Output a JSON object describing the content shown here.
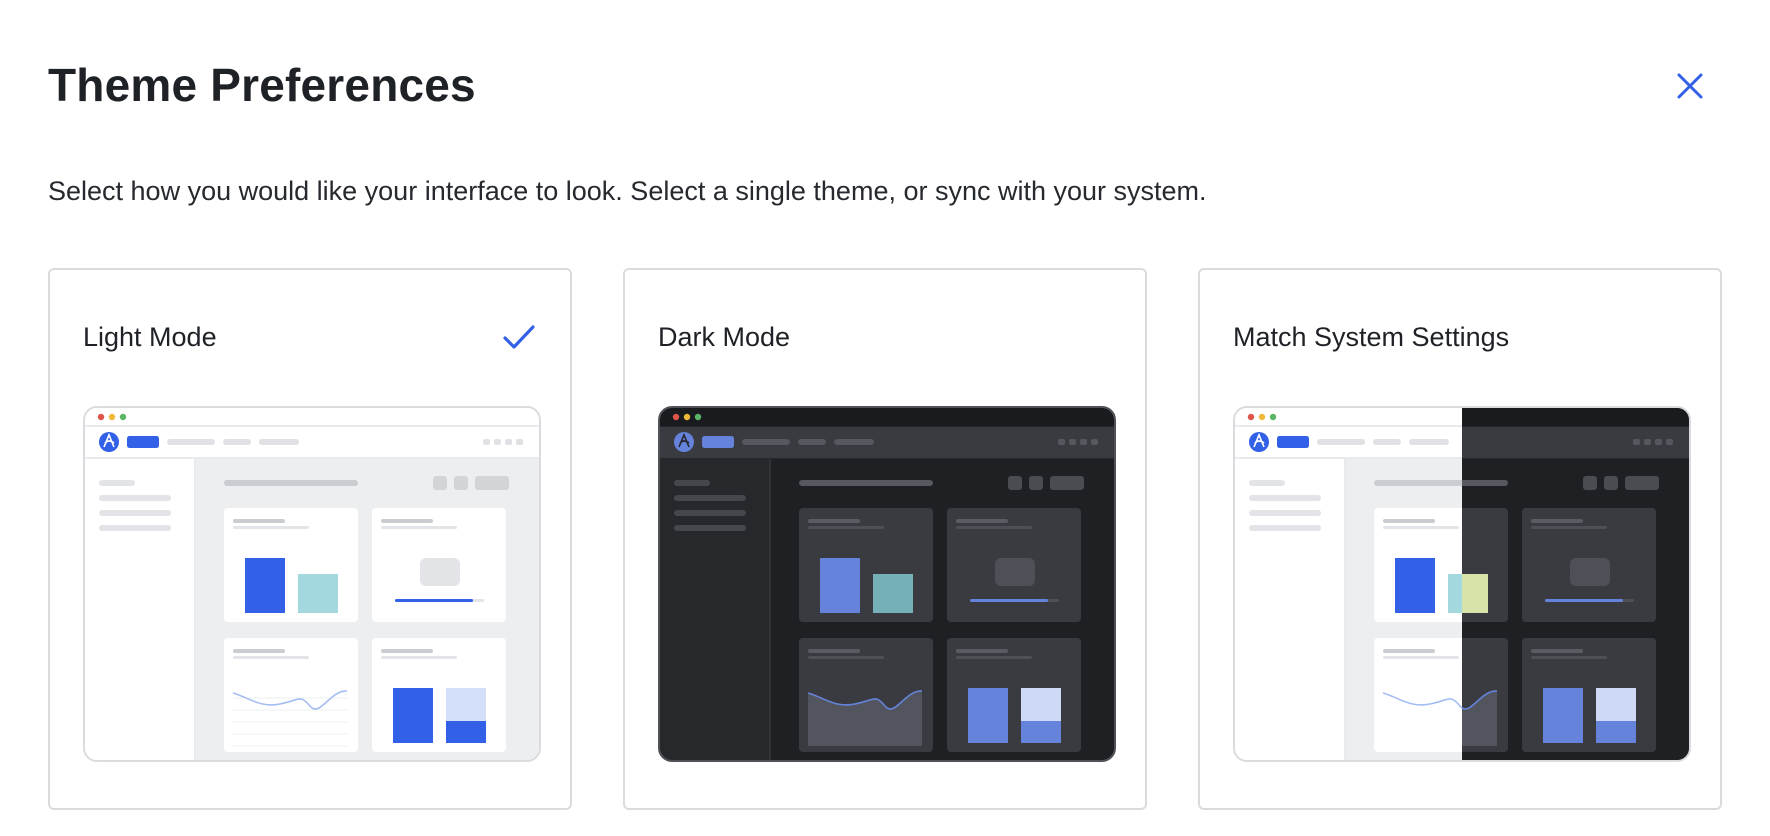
{
  "dialog": {
    "title": "Theme Preferences",
    "description": "Select how you would like your interface to look. Select a single theme, or sync with your system.",
    "close_icon": "close-icon"
  },
  "options": [
    {
      "label": "Light Mode",
      "selected": true,
      "icon": "check-icon"
    },
    {
      "label": "Dark Mode",
      "selected": false
    },
    {
      "label": "Match System Settings",
      "selected": false
    }
  ],
  "colors": {
    "accent": "#3260e6",
    "card_border": "#d9dbde",
    "text": "#1e2125",
    "dark_bg": "#26282c"
  }
}
